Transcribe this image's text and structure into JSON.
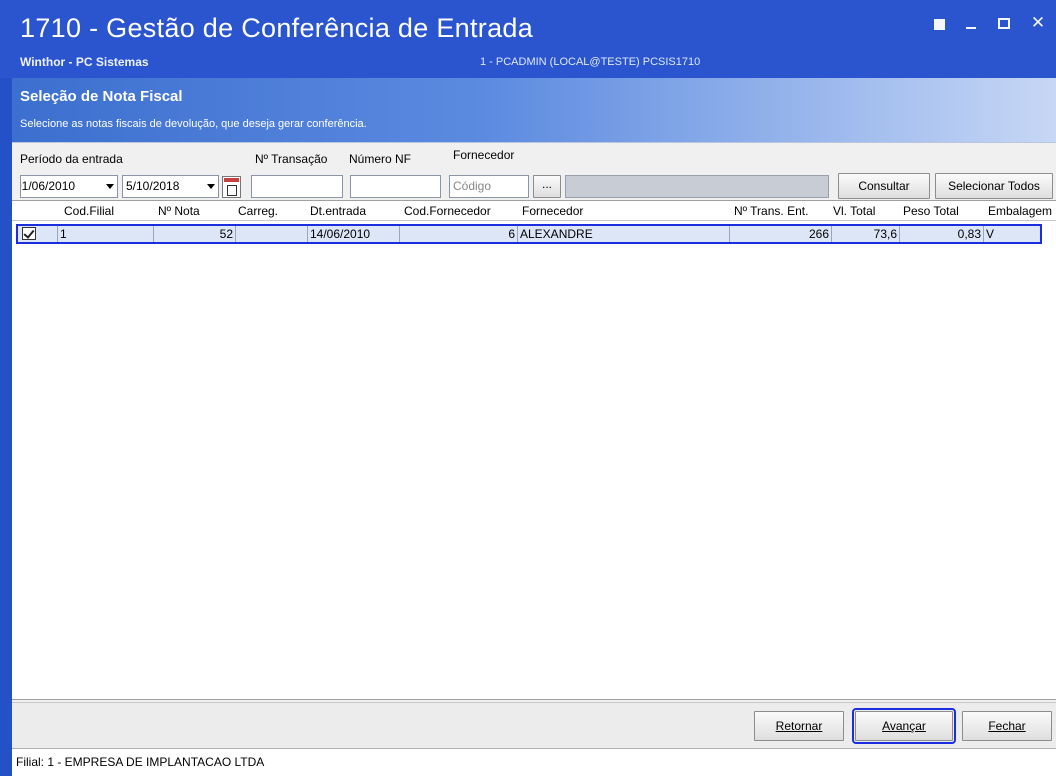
{
  "window": {
    "title": "1710 - Gestão de Conferência de Entrada",
    "company": "Winthor - PC Sistemas",
    "session": "1 - PCADMIN (LOCAL@TESTE)  PCSIS1710"
  },
  "banner": {
    "title": "Seleção de Nota Fiscal",
    "description": "Selecione as notas fiscais de devolução, que deseja gerar conferência."
  },
  "filters": {
    "periodo_label": "Período da entrada",
    "date_from": "01/06/2010",
    "date_to": "5/10/2018",
    "transacao_label": "Nº Transação",
    "transacao_value": "",
    "numero_nf_label": "Número NF",
    "numero_nf_value": "",
    "fornecedor_label": "Fornecedor",
    "fornecedor_placeholder": "Código",
    "browse_label": "...",
    "fornecedor_name": "",
    "consultar_label": "Consultar",
    "selecionar_todos_label": "Selecionar Todos"
  },
  "grid": {
    "columns": [
      "Cod.Filial",
      "Nº Nota",
      "Carreg.",
      "Dt.entrada",
      "Cod.Fornecedor",
      "Fornecedor",
      "Nº Trans. Ent.",
      "Vl. Total",
      "Peso Total",
      "Embalagem"
    ],
    "rows": [
      {
        "selected": true,
        "cod_filial": "1",
        "numero_nota": "52",
        "carreg": "",
        "dt_entrada": "14/06/2010",
        "cod_fornecedor": "6",
        "fornecedor": "ALEXANDRE",
        "num_trans_ent": "266",
        "vl_total": "73,6",
        "peso_total": "0,83",
        "embalagem": "V"
      }
    ]
  },
  "buttons": {
    "retornar": "Retornar",
    "avancar": "Avançar",
    "fechar": "Fechar"
  },
  "status": "Filial: 1 - EMPRESA DE IMPLANTACAO LTDA",
  "colors": {
    "titlebar": "#2a55cf",
    "highlight_border": "#1a2ee0",
    "row_selected": "#dce6f7"
  }
}
